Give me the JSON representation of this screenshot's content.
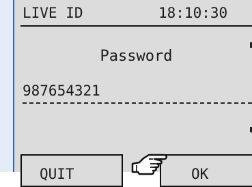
{
  "header": {
    "label": "LIVE ID",
    "time": "18:10:30"
  },
  "prompt": {
    "title": "Password",
    "value": "987654321"
  },
  "buttons": {
    "quit": "QUIT",
    "ok": "OK"
  },
  "icons": {
    "pointer": "pointing-hand-icon"
  },
  "colors": {
    "screen": "#dcdcdc",
    "frame_accent": "#2e66c4"
  }
}
